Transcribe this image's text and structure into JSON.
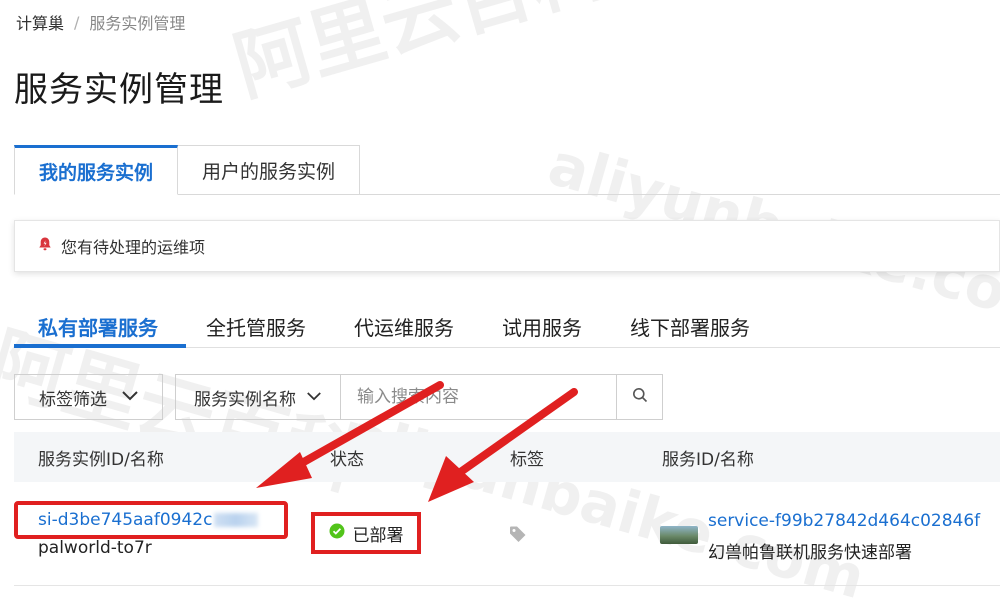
{
  "breadcrumb": {
    "root": "计算巢",
    "separator": "/",
    "current": "服务实例管理"
  },
  "page_title": "服务实例管理",
  "main_tabs": [
    {
      "label": "我的服务实例",
      "active": true
    },
    {
      "label": "用户的服务实例",
      "active": false
    }
  ],
  "todo": {
    "text": "您有待处理的运维项",
    "icon": "alert-bell-icon"
  },
  "sub_tabs": [
    {
      "label": "私有部署服务",
      "active": true
    },
    {
      "label": "全托管服务",
      "active": false
    },
    {
      "label": "代运维服务",
      "active": false
    },
    {
      "label": "试用服务",
      "active": false
    },
    {
      "label": "线下部署服务",
      "active": false
    }
  ],
  "filters": {
    "tag_filter_label": "标签筛选",
    "search_field_label": "服务实例名称",
    "search_placeholder": "输入搜索内容"
  },
  "table": {
    "columns": [
      "服务实例ID/名称",
      "状态",
      "标签",
      "服务ID/名称"
    ],
    "rows": [
      {
        "instance_id": "si-d3be745aaf0942c",
        "instance_name": "palworld-to7r",
        "status": "已部署",
        "status_color": "#52c41a",
        "service_id": "service-f99b27842d464c02846f",
        "service_name": "幻兽帕鲁联机服务快速部署"
      }
    ]
  },
  "watermark": {
    "cn": "阿里云百科",
    "en": "aliyunbaike.com"
  },
  "colors": {
    "accent": "#1a6fd0",
    "annotation": "#e02020"
  }
}
